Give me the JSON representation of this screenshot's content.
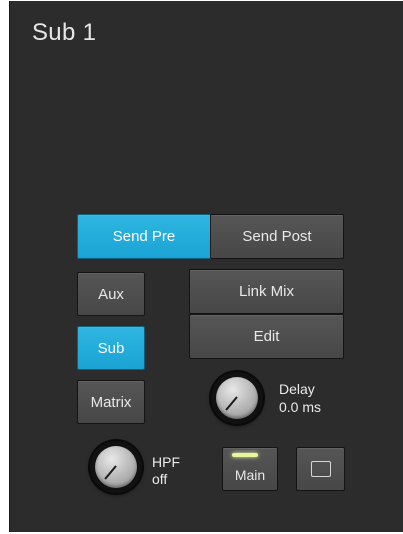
{
  "panel": {
    "title": "Sub 1"
  },
  "send": {
    "pre_label": "Send Pre",
    "post_label": "Send Post",
    "active": "pre"
  },
  "bus_type": {
    "aux_label": "Aux",
    "sub_label": "Sub",
    "matrix_label": "Matrix",
    "active": "sub"
  },
  "actions": {
    "link_mix_label": "Link Mix",
    "edit_label": "Edit"
  },
  "delay": {
    "label": "Delay",
    "value": "0.0 ms"
  },
  "hpf": {
    "label": "HPF",
    "value": "off"
  },
  "main": {
    "label": "Main",
    "led_color": "#e8f79c"
  },
  "colors": {
    "panel_bg": "#2c2c2c",
    "button_bg": "#4d4d4d",
    "accent": "#1fa9da"
  }
}
